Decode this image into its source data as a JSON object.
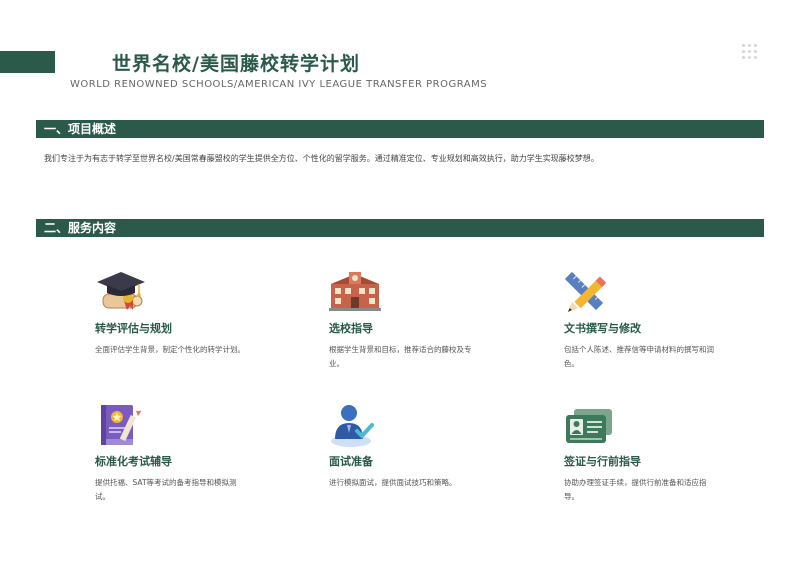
{
  "header": {
    "title": "世界名校/美国藤校转学计划",
    "subtitle": "WORLD RENOWNED SCHOOLS/AMERICAN IVY LEAGUE TRANSFER PROGRAMS"
  },
  "sections": {
    "overview_title": "一、项目概述",
    "overview_text": "我们专注于为有志于转学至世界名校/美国常春藤盟校的学生提供全方位、个性化的留学服务。通过精准定位、专业规划和高效执行，助力学生实现藤校梦想。",
    "services_title": "二、服务内容"
  },
  "services": [
    {
      "title": "转学评估与规划",
      "desc": "全面评估学生背景，制定个性化的转学计划。",
      "icon": "graduation-cap-icon"
    },
    {
      "title": "选校指导",
      "desc": "根据学生背景和目标，推荐适合的藤校及专业。",
      "icon": "school-building-icon"
    },
    {
      "title": "文书撰写与修改",
      "desc": "包括个人陈述、推荐信等申请材料的撰写和润色。",
      "icon": "pencil-ruler-icon"
    },
    {
      "title": "标准化考试辅导",
      "desc": "提供托福、SAT等考试的备考指导和模拟测试。",
      "icon": "exam-book-icon"
    },
    {
      "title": "面试准备",
      "desc": "进行模拟面试，提供面试技巧和策略。",
      "icon": "interview-person-icon"
    },
    {
      "title": "签证与行前指导",
      "desc": "协助办理签证手续，提供行前准备和适应指导。",
      "icon": "id-card-icon"
    }
  ],
  "colors": {
    "primary": "#2b5a4a"
  }
}
